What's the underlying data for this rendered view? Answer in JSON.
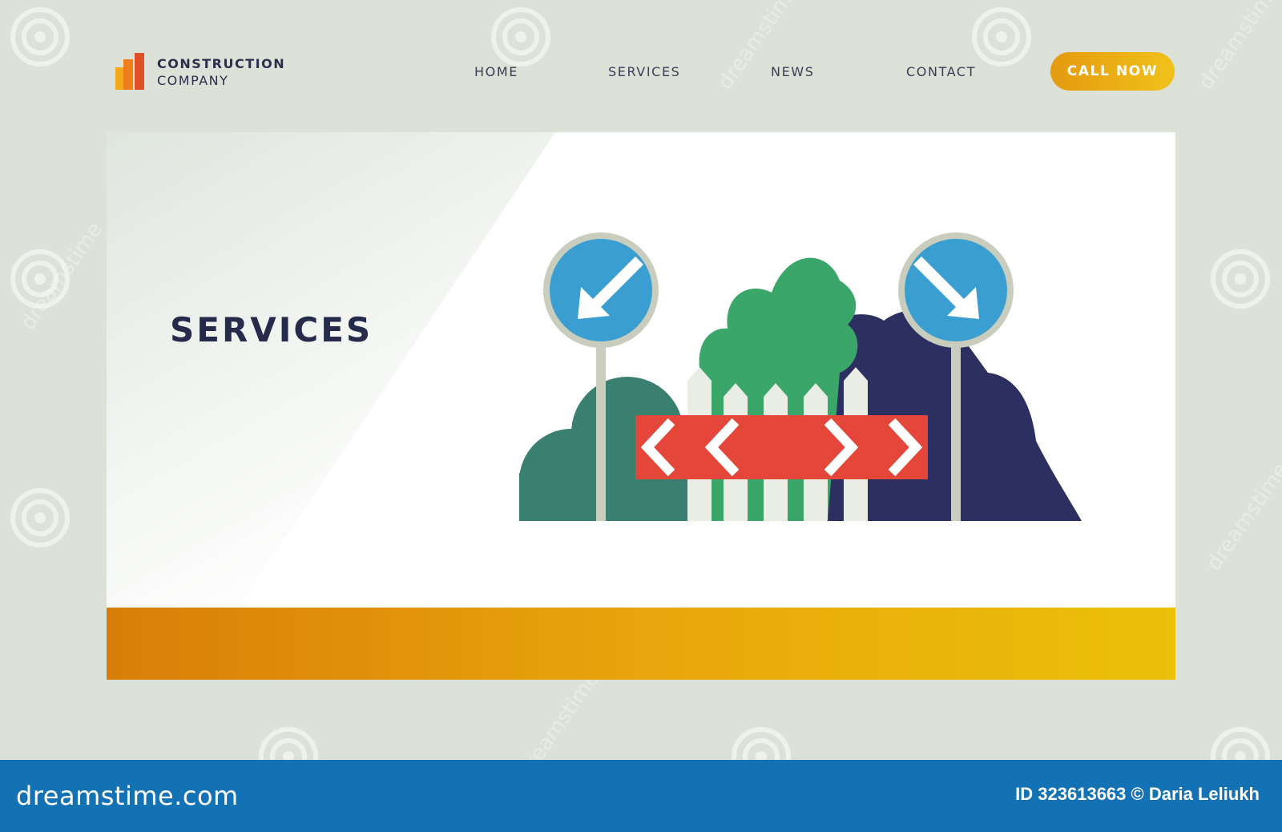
{
  "colors": {
    "background": "#dde2d8",
    "accent_orange": "#e59a10",
    "accent_yellow": "#f0c21a",
    "navy": "#262a4b",
    "sign_blue": "#3a9ed0",
    "barrier_red": "#e4473a",
    "tree_green": "#3aa66a",
    "bush_teal": "#3a8070",
    "hill_navy": "#2c3060",
    "bottom_bar": "#1372b3"
  },
  "header": {
    "logo": {
      "line1": "CONSTRUCTION",
      "line2": "COMPANY",
      "icon": "bar-chart-icon"
    },
    "nav": [
      {
        "label": "HOME"
      },
      {
        "label": "SERVICES"
      },
      {
        "label": "NEWS"
      },
      {
        "label": "CONTACT"
      }
    ],
    "cta_label": "CALL NOW"
  },
  "hero": {
    "title": "SERVICES",
    "illustration": "road-barrier-with-direction-signs"
  },
  "watermark": {
    "brand": "dreamstime.com",
    "credit": "ID 323613663 © Daria Leliukh",
    "text": "dreamstime"
  }
}
